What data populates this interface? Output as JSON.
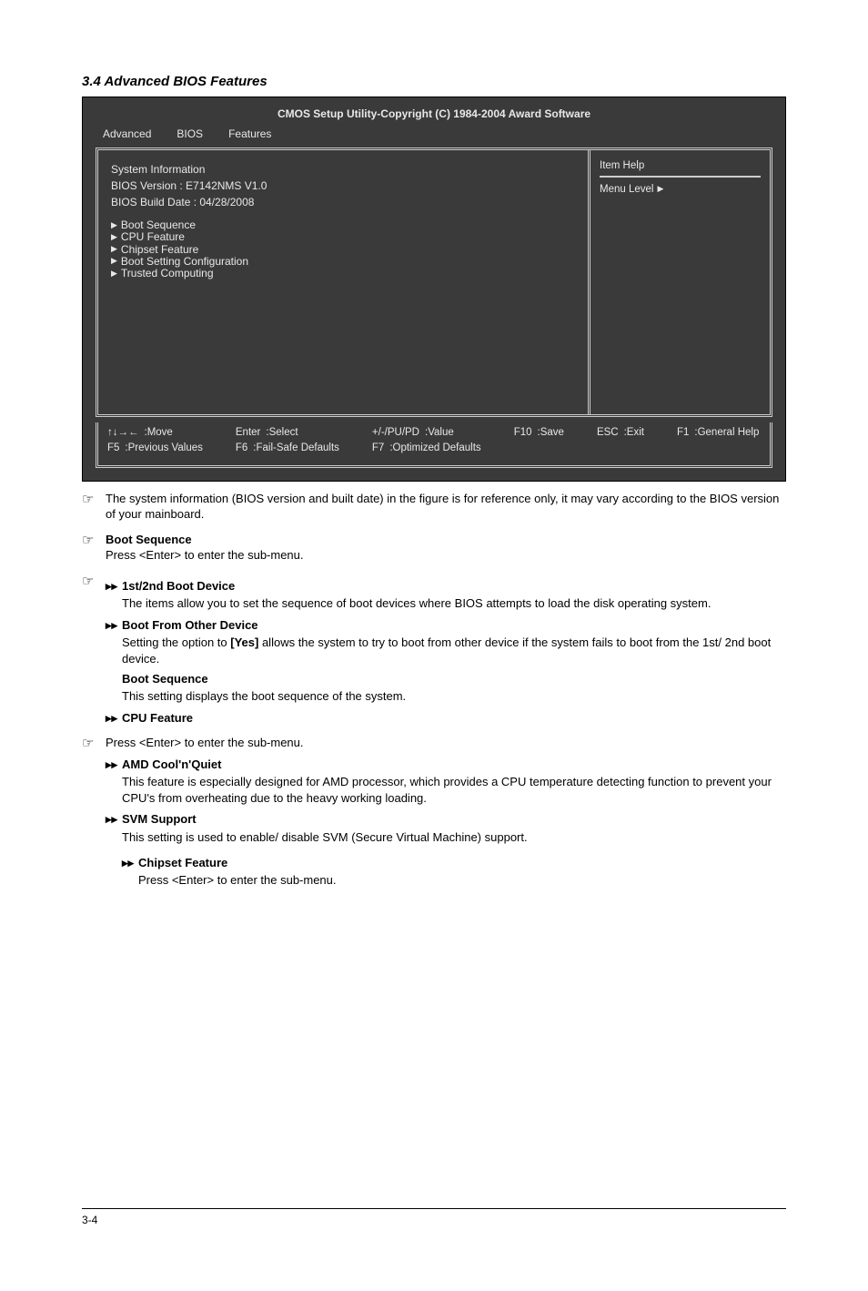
{
  "section": {
    "title": "3.4 Advanced BIOS Features"
  },
  "bios": {
    "title": "CMOS Setup Utility-Copyright (C) 1984-2004 Award Software",
    "tabs": [
      "Advanced",
      "BIOS",
      "Features"
    ],
    "sysinfo": {
      "label": "System Information",
      "line1": "BIOS Version : E7142NMS V1.0",
      "line2": "BIOS Build Date : 04/28/2008",
      "pad1": "",
      "pad2": ""
    },
    "items": {
      "i0": "Boot Sequence",
      "i1": "CPU Feature",
      "i2": "Chipset Feature",
      "i3": "Boot Setting Configuration",
      "i4": "Trusted Computing"
    },
    "help": {
      "title": "Item Help",
      "level": "Menu Level"
    },
    "footer": {
      "c1a": ":Move",
      "c1b_key": "F5",
      "c1b": ":Previous Values",
      "c2a_key": "Enter",
      "c2a": ":Select",
      "c2b_key": "F6",
      "c2b": ":Fail-Safe Defaults",
      "c3a_key": "+/-/PU/PD",
      "c3a": ":Value",
      "c3b_key": "F7",
      "c3b": ":Optimized Defaults",
      "c4a_key": "F10",
      "c4a": ":Save",
      "c5a_key": "ESC",
      "c5a": ":Exit",
      "c6a_key": "F1",
      "c6a": ":General Help"
    }
  },
  "notes": {
    "n1": "The system information (BIOS version and built date) in the figure is for reference only, it may vary according to the BIOS version of your mainboard.",
    "n2": {
      "head": "Boot Sequence",
      "body": "Press <Enter> to enter the sub-menu."
    },
    "n3": {
      "head": "1st/2nd Boot Device",
      "body": "The items allow you to set the sequence of boot devices where BIOS attempts to load the disk operating system."
    },
    "n4": {
      "head": "Boot From Other Device",
      "body_pre": "Setting the option to ",
      "body_em": "[Yes]",
      "body_post": " allows the system to try to boot from other device if the system fails to boot from the 1st/ 2nd boot device."
    },
    "n5": {
      "head": "Boot Sequence",
      "body": "This setting displays the boot sequence of the system."
    },
    "n6": {
      "head": "CPU Feature",
      "body": "Press <Enter> to enter the sub-menu."
    },
    "n7": {
      "head": "AMD Cool'n'Quiet",
      "body": "This feature is especially designed for AMD processor, which provides a CPU temperature detecting function to prevent your CPU's from overheating due to the heavy working loading."
    },
    "n8": {
      "head": "SVM Support",
      "body": "This setting is used to enable/ disable SVM (Secure Virtual Machine) support."
    },
    "n9": {
      "head": "Chipset Feature",
      "body": "Press <Enter> to enter the sub-menu."
    }
  },
  "footer": {
    "left": "3-4",
    "right": ""
  }
}
